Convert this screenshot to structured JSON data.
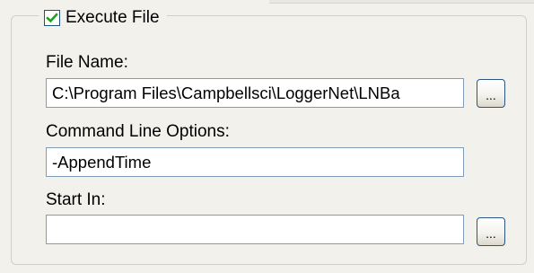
{
  "execute_file": {
    "label": "Execute File",
    "checked": true
  },
  "file_name": {
    "label": "File Name:",
    "value": "C:\\Program Files\\Campbellsci\\LoggerNet\\LNBa",
    "browse_label": "..."
  },
  "command_line_options": {
    "label": "Command Line Options:",
    "value": "-AppendTime"
  },
  "start_in": {
    "label": "Start In:",
    "value": "",
    "browse_label": "..."
  },
  "icons": {
    "checkbox_mark": "checkmark-icon"
  },
  "colors": {
    "panel_background": "#f2f1ec",
    "checkmark_green": "#21a121",
    "field_border": "#7f9db9",
    "button_border": "#2a5585"
  }
}
